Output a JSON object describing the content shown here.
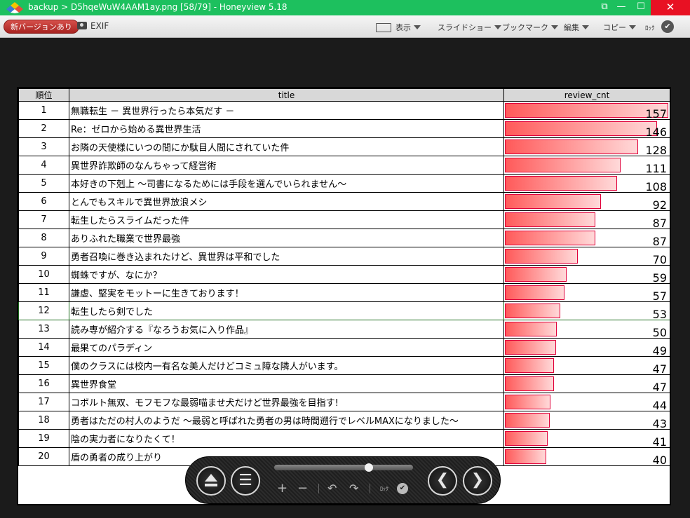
{
  "window": {
    "title": "backup > D5hqeWuW4AAM1ay.png [58/79] - Honeyview 5.18",
    "fullscreen_glyph": "⧉",
    "minimize_glyph": "—",
    "maximize_glyph": "☐",
    "close_glyph": "✕",
    "accent": "#1dc05e"
  },
  "toolbar": {
    "update_label": "新バージョンあり",
    "exif_label": "EXIF",
    "display_label": "表示",
    "slideshow_label": "スライドショー",
    "bookmark_label": "ブックマーク",
    "edit_label": "編集",
    "copy_label": "コピー",
    "lock_label": "ﾛｯｸ",
    "lock_check": "✔"
  },
  "table": {
    "headers": [
      "順位",
      "title",
      "review_cnt"
    ],
    "max_count": 157,
    "rows": [
      {
        "rank": "1",
        "title": "無職転生 － 異世界行ったら本気だす －",
        "count": 157
      },
      {
        "rank": "2",
        "title": "Re：ゼロから始める異世界生活",
        "count": 146
      },
      {
        "rank": "3",
        "title": " お隣の天使様にいつの間にか駄目人間にされていた件",
        "count": 128
      },
      {
        "rank": "4",
        "title": "異世界詐欺師のなんちゃって経営術",
        "count": 111
      },
      {
        "rank": "5",
        "title": "本好きの下剋上 ～司書になるためには手段を選んでいられません～",
        "count": 108
      },
      {
        "rank": "6",
        "title": "とんでもスキルで異世界放浪メシ",
        "count": 92
      },
      {
        "rank": "7",
        "title": "転生したらスライムだった件",
        "count": 87
      },
      {
        "rank": "8",
        "title": "ありふれた職業で世界最強",
        "count": 87
      },
      {
        "rank": "9",
        "title": "勇者召喚に巻き込まれたけど、異世界は平和でした",
        "count": 70
      },
      {
        "rank": "10",
        "title": "蜘蛛ですが、なにか？",
        "count": 59
      },
      {
        "rank": "11",
        "title": "謙虚、堅実をモットーに生きております！",
        "count": 57
      },
      {
        "rank": "12",
        "title": "転生したら剣でした",
        "count": 53
      },
      {
        "rank": "13",
        "title": "読み専が紹介する『なろうお気に入り作品』",
        "count": 50
      },
      {
        "rank": "14",
        "title": "最果てのパラディン",
        "count": 49
      },
      {
        "rank": "15",
        "title": "僕のクラスには校内一有名な美人だけどコミュ障な隣人がいます。",
        "count": 47
      },
      {
        "rank": "16",
        "title": "異世界食堂",
        "count": 47
      },
      {
        "rank": "17",
        "title": "コボルト無双、モフモフな最弱喵ませ犬だけど世界最強を目指す!",
        "count": 44
      },
      {
        "rank": "18",
        "title": "勇者はただの村人のようだ ～最弱と呼ばれた勇者の男は時間遡行でレベルMAXになりました～",
        "count": 43
      },
      {
        "rank": "19",
        "title": "陰の実力者になりたくて！",
        "count": 41
      },
      {
        "rank": "20",
        "title": "盾の勇者の成り上がり",
        "count": 40
      }
    ]
  },
  "controls": {
    "menu_glyph": "☰",
    "prev_glyph": "❮",
    "next_glyph": "❯",
    "zoom_in_glyph": "+",
    "zoom_out_glyph": "−",
    "rotate_left_glyph": "↶",
    "rotate_right_glyph": "↷",
    "lock_label": "ﾛｯｸ",
    "lock_check": "✔",
    "slider_position": 0.68
  }
}
